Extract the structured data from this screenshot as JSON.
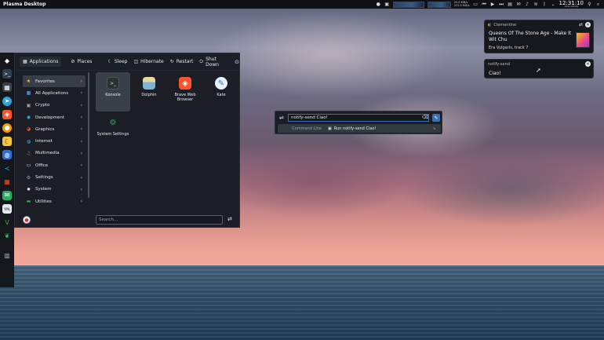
{
  "topbar": {
    "title": "Plasma Desktop",
    "net_up": "20.0 KiB/s",
    "net_down": "222.0 KiB/s",
    "time": "12:31:10",
    "date": "2021-08-06"
  },
  "launcher": {
    "tabs": [
      {
        "label": "Applications"
      },
      {
        "label": "Places"
      }
    ],
    "power": [
      {
        "label": "Sleep"
      },
      {
        "label": "Hibernate"
      },
      {
        "label": "Restart"
      },
      {
        "label": "Shut Down"
      }
    ],
    "categories": [
      {
        "label": "Favorites",
        "icon": "star-icon",
        "color": "#f5c542"
      },
      {
        "label": "All Applications",
        "icon": "grid-icon",
        "color": "#6aa5e8"
      },
      {
        "label": "Crypto",
        "icon": "crypto-icon",
        "color": "#9aa0a9"
      },
      {
        "label": "Development",
        "icon": "development-icon",
        "color": "#3daee9"
      },
      {
        "label": "Graphics",
        "icon": "graphics-icon",
        "color": "#e74c3c"
      },
      {
        "label": "Internet",
        "icon": "internet-icon",
        "color": "#3daee9"
      },
      {
        "label": "Multimedia",
        "icon": "multimedia-icon",
        "color": "#9b59b6"
      },
      {
        "label": "Office",
        "icon": "office-icon",
        "color": "#d8dce2"
      },
      {
        "label": "Settings",
        "icon": "settings-icon",
        "color": "#9aa0a9"
      },
      {
        "label": "System",
        "icon": "system-icon",
        "color": "#e6e9ee"
      },
      {
        "label": "Utilities",
        "icon": "utilities-icon",
        "color": "#27ae60"
      }
    ],
    "apps": [
      {
        "label": "Konsole",
        "icon": "konsole-icon"
      },
      {
        "label": "Dolphin",
        "icon": "dolphin-icon"
      },
      {
        "label": "Brave Web Browser",
        "icon": "brave-icon"
      },
      {
        "label": "Kate",
        "icon": "kate-icon"
      },
      {
        "label": "System Settings",
        "icon": "system-settings-icon"
      }
    ],
    "search_placeholder": "Search..."
  },
  "krunner": {
    "query": "notify-send Ciao!",
    "result_category": "Command Line",
    "result_text": "Run notify-send Ciao!"
  },
  "notifications": [
    {
      "app": "Clementine",
      "title": "Queens Of The Stone Age - Make It Wit Chu",
      "body": "Era Vulgaris, track 7"
    },
    {
      "app": "notify-send",
      "title": "Ciao!"
    }
  ],
  "colors": {
    "accent": "#3b6fb0",
    "panel": "#1b1e24"
  }
}
